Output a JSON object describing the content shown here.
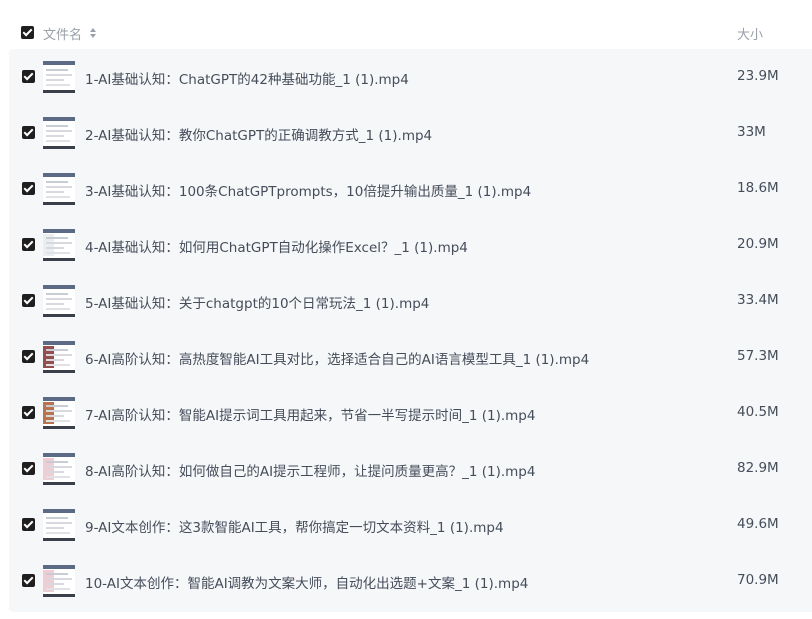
{
  "header": {
    "name_label": "文件名",
    "size_label": "大小",
    "sort_icon": "sort-icon"
  },
  "files": [
    {
      "name": "1-AI基础认知：ChatGPT的42种基础功能_1 (1).mp4",
      "size": "23.9M",
      "thumb_accent": "#ffffff"
    },
    {
      "name": "2-AI基础认知：教你ChatGPT的正确调教方式_1 (1).mp4",
      "size": "33M",
      "thumb_accent": "#ffffff"
    },
    {
      "name": "3-AI基础认知：100条ChatGPTprompts，10倍提升输出质量_1 (1).mp4",
      "size": "18.6M",
      "thumb_accent": "#ffffff"
    },
    {
      "name": "4-AI基础认知：如何用ChatGPT自动化操作Excel？_1 (1).mp4",
      "size": "20.9M",
      "thumb_accent": "#e8ecef"
    },
    {
      "name": "5-AI基础认知：关于chatgpt的10个日常玩法_1 (1).mp4",
      "size": "33.4M",
      "thumb_accent": "#ffffff"
    },
    {
      "name": "6-AI高阶认知：高热度智能AI工具对比，选择适合自己的AI语言模型工具_1 (1).mp4",
      "size": "57.3M",
      "thumb_accent": "#8a3b3b"
    },
    {
      "name": "7-AI高阶认知：智能AI提示词工具用起来，节省一半写提示时间_1 (1).mp4",
      "size": "40.5M",
      "thumb_accent": "#b0643c"
    },
    {
      "name": "8-AI高阶认知：如何做自己的AI提示工程师，让提问质量更高？_1 (1).mp4",
      "size": "82.9M",
      "thumb_accent": "#f1c6cf"
    },
    {
      "name": "9-AI文本创作：这3款智能AI工具，帮你搞定一切文本资料_1 (1).mp4",
      "size": "49.6M",
      "thumb_accent": "#ffffff"
    },
    {
      "name": "10-AI文本创作：智能AI调教为文案大师，自动化出选题+文案_1 (1).mp4",
      "size": "70.9M",
      "thumb_accent": "#f1c6cf"
    }
  ]
}
